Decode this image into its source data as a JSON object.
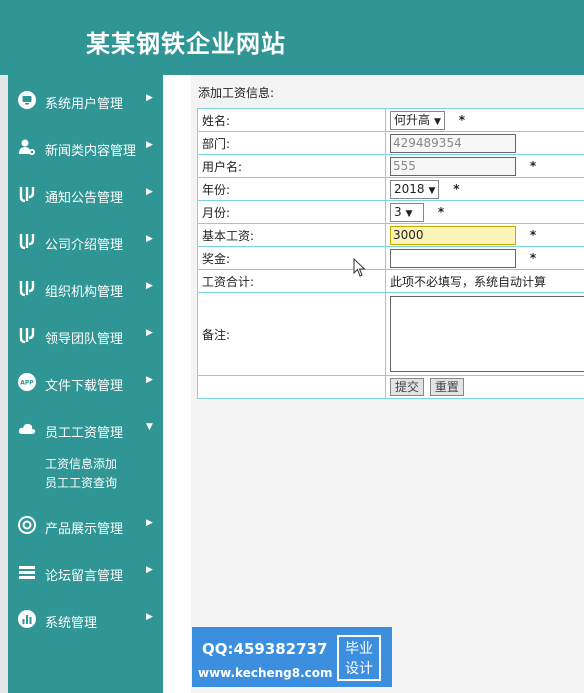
{
  "header": {
    "title": "某某钢铁企业网站"
  },
  "sidebar": {
    "items": [
      {
        "label": "系统用户管理",
        "icon": "monitor-icon",
        "arrow": "▶"
      },
      {
        "label": "新闻类内容管理",
        "icon": "user-gear-icon",
        "arrow": "▶"
      },
      {
        "label": "通知公告管理",
        "icon": "flow-icon",
        "arrow": "▶"
      },
      {
        "label": "公司介绍管理",
        "icon": "flow-icon",
        "arrow": "▶"
      },
      {
        "label": "组织机构管理",
        "icon": "flow-icon",
        "arrow": "▶"
      },
      {
        "label": "领导团队管理",
        "icon": "flow-icon",
        "arrow": "▶"
      },
      {
        "label": "文件下载管理",
        "icon": "app-icon",
        "arrow": "▶"
      },
      {
        "label": "员工工资管理",
        "icon": "cloud-icon",
        "arrow": "▼"
      },
      {
        "label": "产品展示管理",
        "icon": "settings-icon",
        "arrow": "▶"
      },
      {
        "label": "论坛留言管理",
        "icon": "layers-icon",
        "arrow": "▶"
      },
      {
        "label": "系统管理",
        "icon": "chart-icon",
        "arrow": "▶"
      }
    ],
    "subitems": [
      "工资信息添加",
      "员工工资查询"
    ]
  },
  "form": {
    "section_title": "添加工资信息:",
    "rows": {
      "name": {
        "label": "姓名:",
        "value": "何升高"
      },
      "department": {
        "label": "部门:",
        "value": "429489354"
      },
      "username": {
        "label": "用户名:",
        "value": "555"
      },
      "year": {
        "label": "年份:",
        "value": "2018"
      },
      "month": {
        "label": "月份:",
        "value": "3"
      },
      "base_salary": {
        "label": "基本工资:",
        "value": "3000"
      },
      "bonus": {
        "label": "奖金:",
        "value": ""
      },
      "total": {
        "label": "工资合计:",
        "value": "此项不必填写，系统自动计算"
      },
      "remark": {
        "label": "备注:",
        "value": ""
      }
    },
    "required_mark": "*",
    "submit_label": "提交",
    "reset_label": "重置"
  },
  "watermark": {
    "qq": "QQ:459382737",
    "site": "www.kecheng8.com",
    "badge_line1": "毕业",
    "badge_line2": "设计"
  }
}
